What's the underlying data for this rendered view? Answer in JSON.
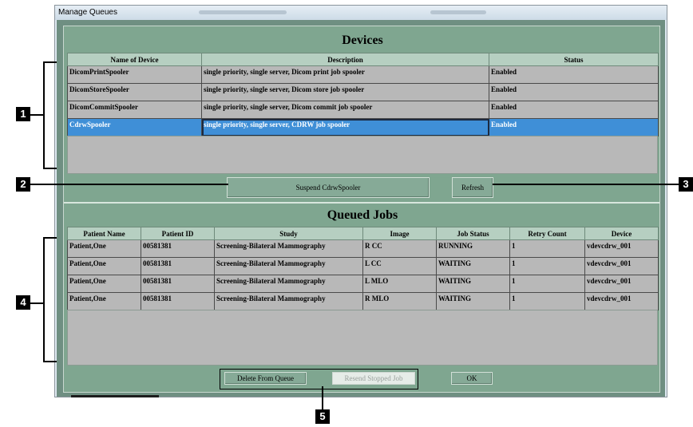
{
  "window": {
    "title": "Manage Queues"
  },
  "devices": {
    "title": "Devices",
    "columns": [
      "Name of Device",
      "Description",
      "Status"
    ],
    "rows": [
      [
        "DicomPrintSpooler",
        "single priority, single server, Dicom print job spooler",
        "Enabled"
      ],
      [
        "DicomStoreSpooler",
        "single priority, single server, Dicom store job spooler",
        "Enabled"
      ],
      [
        "DicomCommitSpooler",
        "single priority, single server, Dicom commit job spooler",
        "Enabled"
      ],
      [
        "CdrwSpooler",
        "single priority, single server, CDRW job spooler",
        "Enabled"
      ]
    ],
    "selected_row": 3
  },
  "buttons": {
    "suspend": "Suspend  CdrwSpooler",
    "refresh": "Refresh",
    "delete": "Delete From Queue",
    "resend": "Resend Stopped Job",
    "ok": "OK"
  },
  "jobs": {
    "title": "Queued Jobs",
    "columns": [
      "Patient Name",
      "Patient ID",
      "Study",
      "Image",
      "Job Status",
      "Retry Count",
      "Device"
    ],
    "rows": [
      [
        "Patient,One",
        "00581381",
        "Screening-Bilateral Mammography",
        "R CC",
        "RUNNING",
        "1",
        "vdevcdrw_001"
      ],
      [
        "Patient,One",
        "00581381",
        "Screening-Bilateral Mammography",
        "L CC",
        "WAITING",
        "1",
        "vdevcdrw_001"
      ],
      [
        "Patient,One",
        "00581381",
        "Screening-Bilateral Mammography",
        "L MLO",
        "WAITING",
        "1",
        "vdevcdrw_001"
      ],
      [
        "Patient,One",
        "00581381",
        "Screening-Bilateral Mammography",
        "R MLO",
        "WAITING",
        "1",
        "vdevcdrw_001"
      ]
    ]
  },
  "callouts": [
    "1",
    "2",
    "3",
    "4",
    "5"
  ],
  "colors": {
    "panel": "#7fa690",
    "selected_row": "#3f8fd7",
    "grid_cell": "#b8b8b8"
  }
}
